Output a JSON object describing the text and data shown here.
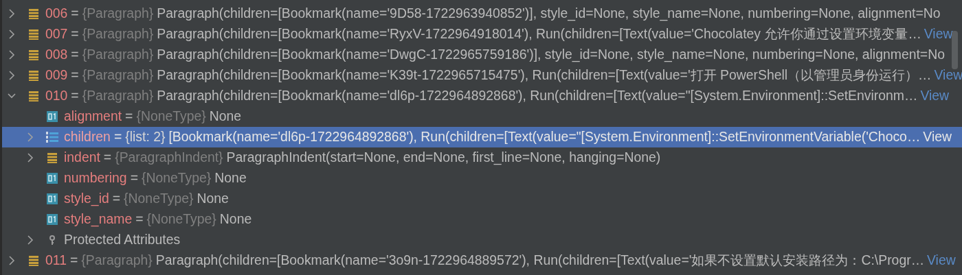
{
  "rows": [
    {
      "name": "006",
      "separator": "=",
      "type": "{Paragraph}",
      "value": "Paragraph(children=[Bookmark(name='9D58-1722963940852')], style_id=None, style_name=None, numbering=None, alignment=No",
      "kind": "object",
      "expanded": false,
      "selected": false
    },
    {
      "name": "007",
      "separator": "=",
      "type": "{Paragraph}",
      "value": "Paragraph(children=[Bookmark(name='RyxV-1722964918014'), Run(children=[Text(value='Chocolatey 允许你通过设置环境变量…",
      "view": "View",
      "kind": "object",
      "expanded": false,
      "selected": false
    },
    {
      "name": "008",
      "separator": "=",
      "type": "{Paragraph}",
      "value": "Paragraph(children=[Bookmark(name='DwgC-1722965759186')], style_id=None, style_name=None, numbering=None, alignment=No",
      "kind": "object",
      "expanded": false,
      "selected": false
    },
    {
      "name": "009",
      "separator": "=",
      "type": "{Paragraph}",
      "value": "Paragraph(children=[Bookmark(name='K39t-1722965715475'), Run(children=[Text(value='打开 PowerShell（以管理员身份运行）…",
      "view": "View",
      "kind": "object",
      "expanded": false,
      "selected": false
    },
    {
      "name": "010",
      "separator": "=",
      "type": "{Paragraph}",
      "value": "Paragraph(children=[Bookmark(name='dl6p-1722964892868'), Run(children=[Text(value=\"[System.Environment]::SetEnvironm…",
      "view": "View",
      "kind": "object",
      "expanded": true,
      "selected": false,
      "children": [
        {
          "name": "alignment",
          "separator": "=",
          "type": "{NoneType}",
          "value": "None",
          "kind": "primitive",
          "selected": false
        },
        {
          "name": "children",
          "separator": "=",
          "type": "{list: 2}",
          "value": "[Bookmark(name='dl6p-1722964892868'), Run(children=[Text(value=\"[System.Environment]::SetEnvironmentVariable('Choco…",
          "view": "View",
          "kind": "list",
          "expanded": false,
          "selected": true
        },
        {
          "name": "indent",
          "separator": "=",
          "type": "{ParagraphIndent}",
          "value": "ParagraphIndent(start=None, end=None, first_line=None, hanging=None)",
          "kind": "object",
          "expanded": false,
          "selected": false
        },
        {
          "name": "numbering",
          "separator": "=",
          "type": "{NoneType}",
          "value": "None",
          "kind": "primitive",
          "selected": false
        },
        {
          "name": "style_id",
          "separator": "=",
          "type": "{NoneType}",
          "value": "None",
          "kind": "primitive",
          "selected": false
        },
        {
          "name": "style_name",
          "separator": "=",
          "type": "{NoneType}",
          "value": "None",
          "kind": "primitive",
          "selected": false
        },
        {
          "label": "Protected Attributes",
          "kind": "key",
          "expanded": false,
          "selected": false
        }
      ]
    },
    {
      "name": "011",
      "separator": "=",
      "type": "{Paragraph}",
      "value": "Paragraph(children=[Bookmark(name='3o9n-1722964889572'), Run(children=[Text(value='如果不设置默认安装路径为：C:\\Progr…",
      "view": "View",
      "kind": "object",
      "expanded": false,
      "selected": false
    }
  ]
}
